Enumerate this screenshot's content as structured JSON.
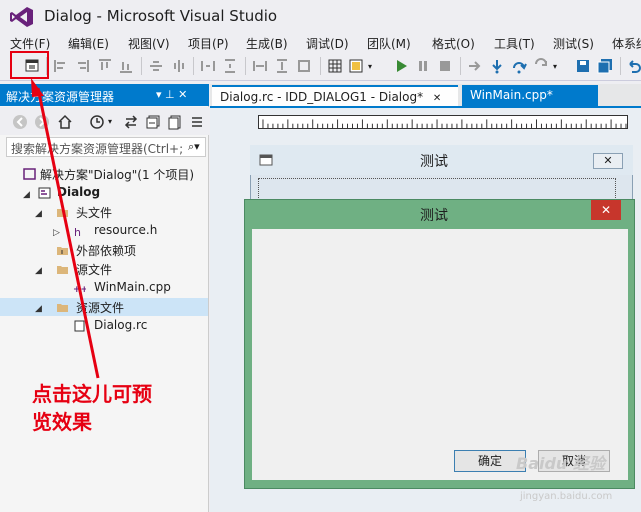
{
  "window": {
    "title": "Dialog - Microsoft Visual Studio",
    "logo_icon": "visual-studio-logo"
  },
  "menubar": {
    "items": [
      "文件(F)",
      "编辑(E)",
      "视图(V)",
      "项目(P)",
      "生成(B)",
      "调试(D)",
      "团队(M)",
      "格式(O)",
      "工具(T)",
      "测试(S)",
      "体系结"
    ]
  },
  "toolbar": {
    "test_dialog_icon": "test-dialog-icon"
  },
  "solution_explorer": {
    "title": "解决方案资源管理器",
    "pin_label": "▾ ⊥ ✕",
    "search_placeholder": "搜索解决方案资源管理器(Ctrl+;",
    "tree": [
      {
        "label": "解决方案\"Dialog\"(1 个项目)",
        "icon": "solution-icon"
      },
      {
        "label": "Dialog",
        "icon": "project-icon",
        "bold": true
      },
      {
        "label": "头文件",
        "icon": "folder-icon"
      },
      {
        "label": "resource.h",
        "icon": "header-file-icon"
      },
      {
        "label": "外部依赖项",
        "icon": "dependency-icon"
      },
      {
        "label": "源文件",
        "icon": "folder-icon"
      },
      {
        "label": "WinMain.cpp",
        "icon": "cpp-file-icon"
      },
      {
        "label": "资源文件",
        "icon": "folder-icon"
      },
      {
        "label": "Dialog.rc",
        "icon": "rc-file-icon"
      }
    ]
  },
  "tabs": [
    {
      "label": "Dialog.rc - IDD_DIALOG1 - Dialog*",
      "close": "✕",
      "active": true
    },
    {
      "label": "WinMain.cpp*",
      "active": false
    }
  ],
  "designer_dialog": {
    "caption": "测试",
    "close": "✕"
  },
  "preview_dialog": {
    "caption": "测试",
    "close": "✕",
    "ok_label": "确定",
    "cancel_label": "取消"
  },
  "annotation": {
    "line1": "点击这儿可预",
    "line2": "览效果",
    "color": "#e60012"
  },
  "watermark": {
    "text": "Baidu 经验",
    "url": "jingyan.baidu.com"
  },
  "colors": {
    "accent": "#007acc",
    "dialog_green": "#6fb083",
    "close_red": "#c7362c"
  }
}
